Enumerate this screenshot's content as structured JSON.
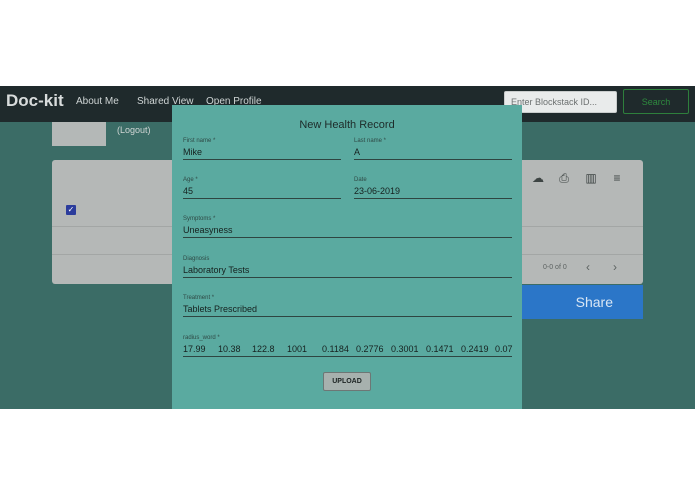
{
  "navbar": {
    "brand": "Doc-kit",
    "links": [
      "About Me",
      "Shared View",
      "Open Profile"
    ],
    "search_placeholder": "Enter Blockstack ID...",
    "search_button": "Search"
  },
  "background": {
    "logout_label": "(Logout)",
    "table_icons": [
      "cloud-download-icon",
      "print-icon",
      "view-column-icon",
      "filter-icon"
    ],
    "pagination_text": "0-0 of 0",
    "share_button": "Share"
  },
  "modal": {
    "title": "New Health Record",
    "fields": {
      "first_name": {
        "label": "First name *",
        "value": "Mike"
      },
      "last_name": {
        "label": "Last name *",
        "value": "A"
      },
      "age": {
        "label": "Age *",
        "value": "45"
      },
      "date": {
        "label": "Date",
        "value": "23-06-2019"
      },
      "symptoms": {
        "label": "Symptoms *",
        "value": "Uneasyness"
      },
      "diagnosis": {
        "label": "Diagnosis",
        "value": "Laboratory Tests"
      },
      "treatment": {
        "label": "Treatment *",
        "value": "Tablets Prescribed"
      },
      "radius_word": {
        "label": "radius_word *",
        "values": [
          "17.99",
          "10.38",
          "122.8",
          "1001",
          "0.1184",
          "0.2776",
          "0.3001",
          "0.1471",
          "0.2419",
          "0.07"
        ]
      }
    },
    "upload_button": "UPLOAD"
  },
  "colors": {
    "navbar": "#1f2a2c",
    "backdrop": "#3b6c66",
    "modal": "#5aaaa0",
    "share_button": "#2b76c8",
    "search_button": "#2e8a3e"
  }
}
